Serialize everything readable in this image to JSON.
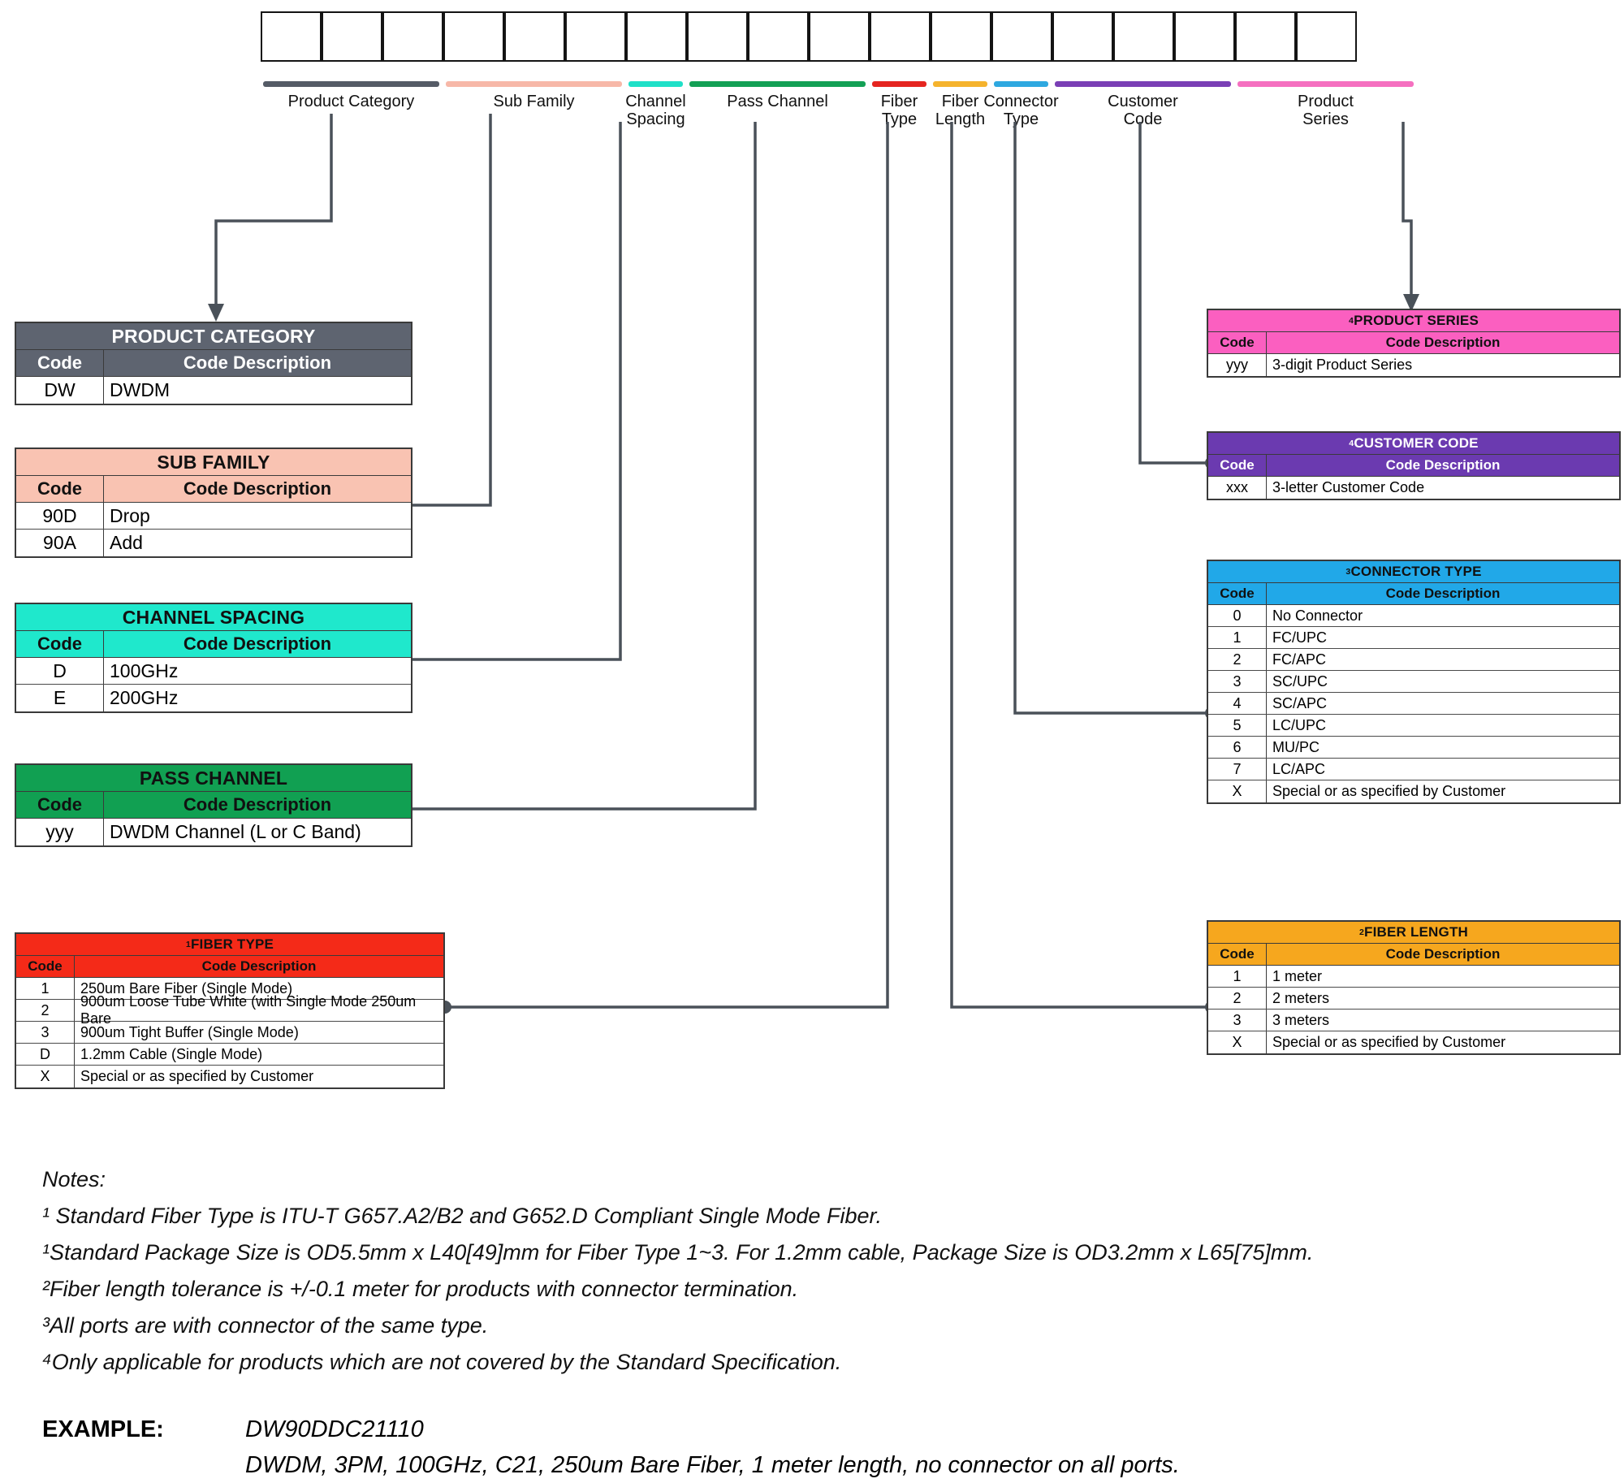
{
  "part_number_boxes": 18,
  "fields": [
    {
      "name": "Product Category",
      "label": "Product Category",
      "color": "#555b66",
      "boxes": 3
    },
    {
      "name": "Sub Family",
      "label": "Sub Family",
      "color": "#f7b8a8",
      "boxes": 3
    },
    {
      "name": "Channel Spacing",
      "label": "Channel\nSpacing",
      "color": "#1fe0c8",
      "boxes": 1
    },
    {
      "name": "Pass Channel",
      "label": "Pass Channel",
      "color": "#13a055",
      "boxes": 3
    },
    {
      "name": "Fiber Type",
      "label": "Fiber\nType",
      "color": "#e52520",
      "boxes": 1
    },
    {
      "name": "Fiber Length",
      "label": "Fiber\nLength",
      "color": "#f5b32d",
      "boxes": 1
    },
    {
      "name": "Connector Type",
      "label": "Connector\nType",
      "color": "#2ea8e0",
      "boxes": 1
    },
    {
      "name": "Customer Code",
      "label": "Customer\nCode",
      "color": "#7a3fb5",
      "boxes": 3
    },
    {
      "name": "Product Series",
      "label": "Product\nSeries",
      "color": "#f570c0",
      "boxes": 3
    }
  ],
  "tables": {
    "product_category": {
      "title": "PRODUCT CATEGORY",
      "superscript": "",
      "header_color": "#5e6470",
      "title_text_color": "#ffffff",
      "header_text_color": "#ffffff",
      "columns": [
        "Code",
        "Code Description"
      ],
      "rows": [
        [
          "DW",
          "DWDM"
        ]
      ]
    },
    "sub_family": {
      "title": "SUB FAMILY",
      "superscript": "",
      "header_color": "#f9c3b2",
      "title_text_color": "#111111",
      "header_text_color": "#111111",
      "columns": [
        "Code",
        "Code Description"
      ],
      "rows": [
        [
          "90D",
          "Drop"
        ],
        [
          "90A",
          "Add"
        ]
      ]
    },
    "channel_spacing": {
      "title": "CHANNEL SPACING",
      "superscript": "",
      "header_color": "#1fe8cc",
      "title_text_color": "#111111",
      "header_text_color": "#111111",
      "columns": [
        "Code",
        "Code Description"
      ],
      "rows": [
        [
          "D",
          "100GHz"
        ],
        [
          "E",
          "200GHz"
        ]
      ]
    },
    "pass_channel": {
      "title": "PASS CHANNEL",
      "superscript": "",
      "header_color": "#11a052",
      "title_text_color": "#111111",
      "header_text_color": "#111111",
      "columns": [
        "Code",
        "Code Description"
      ],
      "rows": [
        [
          "yyy",
          "DWDM Channel (L or C Band)"
        ]
      ]
    },
    "fiber_type": {
      "title": "FIBER TYPE",
      "superscript": "1",
      "header_color": "#f42a18",
      "title_text_color": "#111111",
      "header_text_color": "#111111",
      "columns": [
        "Code",
        "Code Description"
      ],
      "rows": [
        [
          "1",
          "250um Bare Fiber (Single Mode)"
        ],
        [
          "2",
          "900um Loose Tube White (with Single Mode 250um Bare"
        ],
        [
          "3",
          "900um Tight Buffer (Single Mode)"
        ],
        [
          "D",
          "1.2mm Cable (Single Mode)"
        ],
        [
          "X",
          "Special or as specified by Customer"
        ]
      ]
    },
    "product_series": {
      "title": "PRODUCT SERIES",
      "superscript": "4",
      "header_color": "#fb5fc0",
      "title_text_color": "#111111",
      "header_text_color": "#111111",
      "columns": [
        "Code",
        "Code Description"
      ],
      "rows": [
        [
          "yyy",
          "3-digit Product Series"
        ]
      ]
    },
    "customer_code": {
      "title": "CUSTOMER CODE",
      "superscript": "4",
      "header_color": "#6b3ab0",
      "title_text_color": "#ffffff",
      "header_text_color": "#ffffff",
      "columns": [
        "Code",
        "Code Description"
      ],
      "rows": [
        [
          "xxx",
          "3-letter Customer Code"
        ]
      ]
    },
    "connector_type": {
      "title": "CONNECTOR TYPE",
      "superscript": "3",
      "header_color": "#21a8e8",
      "title_text_color": "#111111",
      "header_text_color": "#111111",
      "columns": [
        "Code",
        "Code Description"
      ],
      "rows": [
        [
          "0",
          "No Connector"
        ],
        [
          "1",
          "FC/UPC"
        ],
        [
          "2",
          "FC/APC"
        ],
        [
          "3",
          "SC/UPC"
        ],
        [
          "4",
          "SC/APC"
        ],
        [
          "5",
          "LC/UPC"
        ],
        [
          "6",
          "MU/PC"
        ],
        [
          "7",
          "LC/APC"
        ],
        [
          "X",
          "Special or as specified by Customer"
        ]
      ]
    },
    "fiber_length": {
      "title": "FIBER LENGTH",
      "superscript": "2",
      "header_color": "#f6a71e",
      "title_text_color": "#111111",
      "header_text_color": "#111111",
      "columns": [
        "Code",
        "Code Description"
      ],
      "rows": [
        [
          "1",
          "1 meter"
        ],
        [
          "2",
          "2 meters"
        ],
        [
          "3",
          "3 meters"
        ],
        [
          "X",
          "Special or as specified by Customer"
        ]
      ]
    }
  },
  "notes": {
    "heading": "Notes:",
    "lines": [
      "¹ Standard Fiber Type is ITU-T G657.A2/B2 and G652.D Compliant Single Mode Fiber.",
      "¹Standard Package Size is OD5.5mm x L40[49]mm for Fiber Type 1~3. For 1.2mm cable, Package Size is OD3.2mm x L65[75]mm.",
      "²Fiber length tolerance is +/-0.1 meter for products with connector termination.",
      "³All ports are with connector of the same type.",
      "⁴Only applicable for products which are not covered by the Standard Specification."
    ]
  },
  "example": {
    "label": "EXAMPLE:",
    "part_number": "DW90DDC21110",
    "description": "DWDM, 3PM, 100GHz, C21, 250um Bare Fiber, 1 meter length, no connector on all ports."
  }
}
